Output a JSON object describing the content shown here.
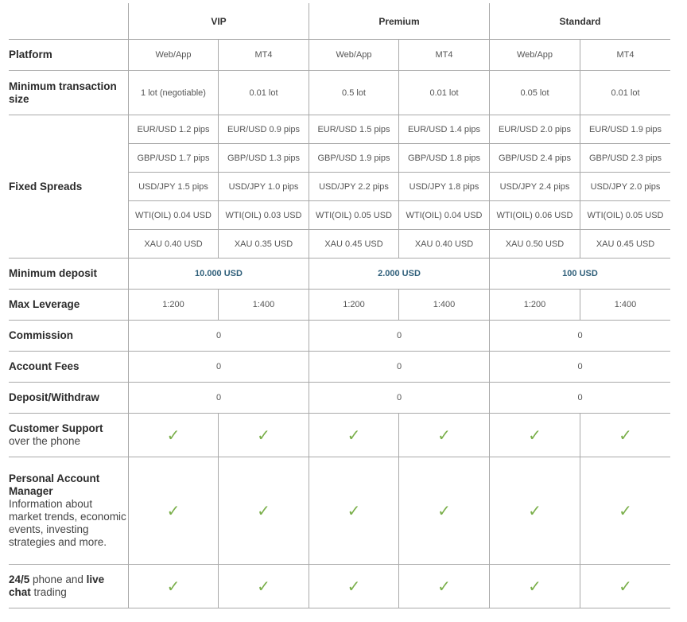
{
  "groups": [
    {
      "name": "VIP"
    },
    {
      "name": "Premium"
    },
    {
      "name": "Standard"
    }
  ],
  "rows": {
    "platform": {
      "label": "Platform",
      "values": [
        "Web/App",
        "MT4",
        "Web/App",
        "MT4",
        "Web/App",
        "MT4"
      ]
    },
    "min_transaction": {
      "label": "Minimum transaction size",
      "values": [
        "1 lot (negotiable)",
        "0.01 lot",
        "0.5 lot",
        "0.01 lot",
        "0.05 lot",
        "0.01 lot"
      ]
    },
    "fixed_spreads": {
      "label": "Fixed Spreads",
      "instruments": [
        {
          "values": [
            "EUR/USD 1.2 pips",
            "EUR/USD 0.9 pips",
            "EUR/USD 1.5 pips",
            "EUR/USD 1.4 pips",
            "EUR/USD 2.0 pips",
            "EUR/USD 1.9 pips"
          ]
        },
        {
          "values": [
            "GBP/USD 1.7 pips",
            "GBP/USD 1.3 pips",
            "GBP/USD 1.9 pips",
            "GBP/USD 1.8 pips",
            "GBP/USD 2.4 pips",
            "GBP/USD 2.3 pips"
          ]
        },
        {
          "values": [
            "USD/JPY 1.5 pips",
            "USD/JPY 1.0 pips",
            "USD/JPY 2.2 pips",
            "USD/JPY 1.8 pips",
            "USD/JPY 2.4 pips",
            "USD/JPY 2.0 pips"
          ]
        },
        {
          "values": [
            "WTI(OIL) 0.04 USD",
            "WTI(OIL) 0.03 USD",
            "WTI(OIL) 0.05 USD",
            "WTI(OIL) 0.04 USD",
            "WTI(OIL) 0.06 USD",
            "WTI(OIL) 0.05 USD"
          ]
        },
        {
          "values": [
            "XAU 0.40 USD",
            "XAU 0.35 USD",
            "XAU 0.45 USD",
            "XAU 0.40 USD",
            "XAU 0.50 USD",
            "XAU 0.45 USD"
          ]
        }
      ]
    },
    "min_deposit": {
      "label": "Minimum deposit",
      "values": [
        "10.000 USD",
        "2.000 USD",
        "100 USD"
      ],
      "accent_color": "#2f5f7a"
    },
    "max_leverage": {
      "label": "Max Leverage",
      "values": [
        "1:200",
        "1:400",
        "1:200",
        "1:400",
        "1:200",
        "1:400"
      ]
    },
    "commission": {
      "label": "Commission",
      "values": [
        "0",
        "0",
        "0"
      ]
    },
    "account_fees": {
      "label": "Account Fees",
      "values": [
        "0",
        "0",
        "0"
      ]
    },
    "deposit_withdraw": {
      "label": "Deposit/Withdraw",
      "values": [
        "0",
        "0",
        "0"
      ]
    },
    "customer_support": {
      "label_bold": "Customer Support",
      "label_plain": "over the phone",
      "values": [
        "check",
        "check",
        "check",
        "check",
        "check",
        "check"
      ]
    },
    "account_manager": {
      "label_bold": "Personal Account Manager",
      "label_plain": "Information about market trends, economic events, investing strategies and more.",
      "values": [
        "check",
        "check",
        "check",
        "check",
        "check",
        "check"
      ]
    },
    "live_chat": {
      "label_bold_1": "24/5",
      "label_plain_1": " phone and ",
      "label_bold_2": "live chat",
      "label_plain_2": " trading",
      "values": [
        "check",
        "check",
        "check",
        "check",
        "check",
        "check"
      ]
    }
  },
  "icons": {
    "check": "✓",
    "check_color": "#7aaf4a"
  }
}
